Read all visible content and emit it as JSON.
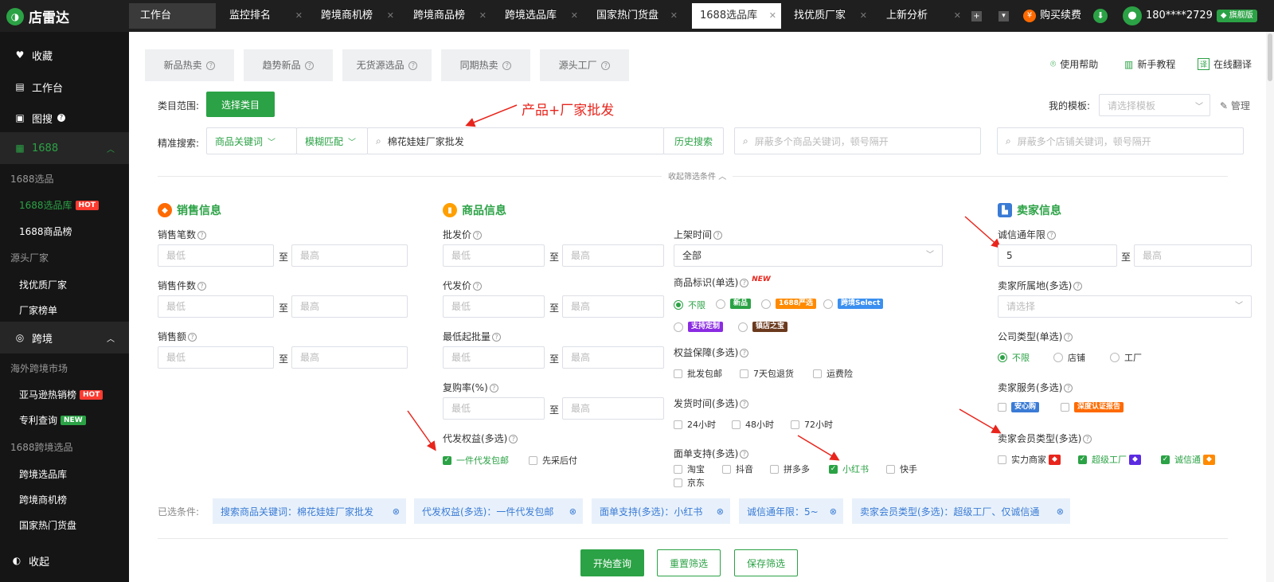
{
  "brand": {
    "name": "店雷达"
  },
  "tabs": [
    {
      "label": "工作台"
    },
    {
      "label": "监控排名"
    },
    {
      "label": "跨境商机榜"
    },
    {
      "label": "跨境商品榜"
    },
    {
      "label": "跨境选品库"
    },
    {
      "label": "国家热门货盘"
    },
    {
      "label": "1688选品库"
    },
    {
      "label": "找优质厂家"
    },
    {
      "label": "上新分析"
    }
  ],
  "topbar": {
    "buy": "购买续费",
    "phone": "180****2729",
    "vip": "旗舰版"
  },
  "sidebar": {
    "favorites": "收藏",
    "workbench": "工作台",
    "image_search": "图搜",
    "g1688": "1688",
    "sec_1688": "1688选品",
    "item_1688_lib": "1688选品库",
    "item_1688_rank": "1688商品榜",
    "sec_factory": "源头厂家",
    "item_factory": "找优质厂家",
    "item_factory_rank": "厂家榜单",
    "cross": "跨境",
    "sec_overseas": "海外跨境市场",
    "item_amazon": "亚马逊热销榜",
    "item_patent": "专利查询",
    "sec_1688cross": "1688跨境选品",
    "item_cross_lib": "跨境选品库",
    "item_cross_opp": "跨境商机榜",
    "item_country": "国家热门货盘",
    "collapse": "收起",
    "hot": "HOT",
    "new": "NEW"
  },
  "subtabs": [
    "新品热卖",
    "趋势新品",
    "无货源选品",
    "同期热卖",
    "源头工厂"
  ],
  "help": {
    "usage": "使用帮助",
    "tutorial": "新手教程",
    "translate": "在线翻译"
  },
  "filter": {
    "category_label": "类目范围:",
    "category_btn": "选择类目",
    "template_label": "我的模板:",
    "template_placeholder": "请选择模板",
    "manage": "管理",
    "search_label": "精准搜索:",
    "keyword_type": "商品关键词",
    "match_type": "模糊匹配",
    "keyword": "棉花娃娃厂家批发",
    "history": "历史搜索",
    "block_goods": "屏蔽多个商品关键词，顿号隔开",
    "block_shop": "屏蔽多个店铺关键词，顿号隔开",
    "collapse": "收起筛选条件"
  },
  "annotation": "产品+厂家批发",
  "sales": {
    "title": "销售信息",
    "count": "销售笔数",
    "pieces": "销售件数",
    "amount": "销售额"
  },
  "goods": {
    "title": "商品信息",
    "wholesale": "批发价",
    "dropship": "代发价",
    "moq": "最低起批量",
    "repurchase": "复购率(%)",
    "rights": "代发权益(多选)",
    "rights_opts": [
      "一件代发包邮",
      "先采后付"
    ]
  },
  "mid": {
    "listing_time": "上架时间",
    "listing_value": "全部",
    "mark": "商品标识(单选)",
    "mark_new": "NEW",
    "mark_opts": [
      "不限",
      "新品",
      "1688严选",
      "跨境Select",
      "支持定制",
      "镇店之宝"
    ],
    "protect": "权益保障(多选)",
    "protect_opts": [
      "批发包邮",
      "7天包退货",
      "运费险"
    ],
    "ship": "发货时间(多选)",
    "ship_opts": [
      "24小时",
      "48小时",
      "72小时"
    ],
    "sheet": "面单支持(多选)",
    "sheet_opts": [
      "淘宝",
      "抖音",
      "拼多多",
      "小红书",
      "快手",
      "京东"
    ]
  },
  "seller": {
    "title": "卖家信息",
    "years": "诚信通年限",
    "years_min": "5",
    "location": "卖家所属地(多选)",
    "location_placeholder": "请选择",
    "company": "公司类型(单选)",
    "company_opts": [
      "不限",
      "店铺",
      "工厂"
    ],
    "service": "卖家服务(多选)",
    "service_opts": [
      "安心购",
      "深度认证报告"
    ],
    "member": "卖家会员类型(多选)",
    "member_opts": [
      "实力商家",
      "超级工厂",
      "诚信通"
    ]
  },
  "placeholders": {
    "min": "最低",
    "max": "最高",
    "to": "至"
  },
  "selected": {
    "label": "已选条件:",
    "chips": [
      "搜索商品关键词：棉花娃娃厂家批发",
      "代发权益(多选)：一件代发包邮",
      "面单支持(多选)：小红书",
      "诚信通年限：5~",
      "卖家会员类型(多选)：超级工厂、仅诚信通"
    ]
  },
  "actions": {
    "query": "开始查询",
    "reset": "重置筛选",
    "save": "保存筛选"
  },
  "colors": {
    "accent": "#2ba245",
    "annotation": "#e8251c",
    "chip": "#3a7bd5"
  }
}
